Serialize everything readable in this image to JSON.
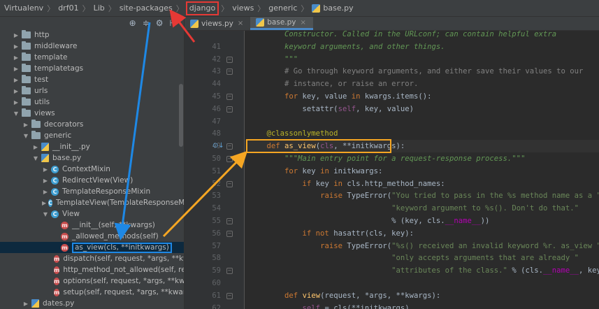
{
  "breadcrumb": {
    "items": [
      "Virtualenv",
      "drf01",
      "Lib",
      "site-packages",
      "django",
      "views",
      "generic",
      "base.py"
    ],
    "highlighted_index": 4,
    "separator": "〉"
  },
  "project_panel": {
    "toolbar_icons": [
      "crosshair-icon",
      "collapse-icon",
      "gear-icon",
      "hide-icon"
    ],
    "tree": [
      {
        "label": "http",
        "type": "folder",
        "expanded": false
      },
      {
        "label": "middleware",
        "type": "folder",
        "expanded": false
      },
      {
        "label": "template",
        "type": "folder",
        "expanded": false
      },
      {
        "label": "templatetags",
        "type": "folder",
        "expanded": false
      },
      {
        "label": "test",
        "type": "folder",
        "expanded": false
      },
      {
        "label": "urls",
        "type": "folder",
        "expanded": false
      },
      {
        "label": "utils",
        "type": "folder",
        "expanded": false
      },
      {
        "label": "views",
        "type": "folder",
        "expanded": true
      },
      {
        "label": "decorators",
        "type": "folder",
        "expanded": false
      },
      {
        "label": "generic",
        "type": "folder",
        "expanded": true
      },
      {
        "label": "__init__.py",
        "type": "file",
        "expanded": false
      },
      {
        "label": "base.py",
        "type": "file",
        "expanded": true
      },
      {
        "label": "ContextMixin",
        "type": "class",
        "expanded": false
      },
      {
        "label": "RedirectView(View)",
        "type": "class",
        "expanded": false
      },
      {
        "label": "TemplateResponseMixin",
        "type": "class",
        "expanded": false
      },
      {
        "label": "TemplateView(TemplateResponseMixin",
        "type": "class",
        "expanded": false
      },
      {
        "label": "View",
        "type": "class",
        "expanded": true
      },
      {
        "label": "__init__(self, **kwargs)",
        "type": "method"
      },
      {
        "label": "_allowed_methods(self)",
        "type": "method"
      },
      {
        "label": "as_view(cls, **initkwargs)",
        "type": "method",
        "selected": true
      },
      {
        "label": "dispatch(self, request, *args, **kwa",
        "type": "method"
      },
      {
        "label": "http_method_not_allowed(self, rec",
        "type": "method"
      },
      {
        "label": "options(self, request, *args, **kwa",
        "type": "method"
      },
      {
        "label": "setup(self, request, *args, **kwarg",
        "type": "method"
      },
      {
        "label": "dates.py",
        "type": "file",
        "expanded": false
      }
    ]
  },
  "tabs": [
    {
      "label": "views.py",
      "active": false
    },
    {
      "label": "base.py",
      "active": true
    }
  ],
  "editor": {
    "current_line": 49,
    "lines": [
      {
        "n": "",
        "tokens": [
          [
            "        Constructor. Called in the URLconf; can contain helpful extra",
            "docstr"
          ]
        ]
      },
      {
        "n": "41",
        "tokens": [
          [
            "        keyword arguments, and other things.",
            "docstr"
          ]
        ]
      },
      {
        "n": "42",
        "tokens": [
          [
            "        \"\"\"",
            "docstr"
          ]
        ]
      },
      {
        "n": "43",
        "tokens": [
          [
            "        # Go through keyword arguments, and either save their values to our",
            "cm"
          ]
        ]
      },
      {
        "n": "44",
        "tokens": [
          [
            "        # instance, or raise an error.",
            "cm"
          ]
        ]
      },
      {
        "n": "45",
        "tokens": [
          [
            "        ",
            "pl"
          ],
          [
            "for",
            "kw"
          ],
          [
            " key, value ",
            "pl"
          ],
          [
            "in",
            "kw"
          ],
          [
            " kwargs.items():",
            "pl"
          ]
        ]
      },
      {
        "n": "46",
        "tokens": [
          [
            "            setattr(",
            "pl"
          ],
          [
            "self",
            "self"
          ],
          [
            ", key, value)",
            "pl"
          ]
        ]
      },
      {
        "n": "47",
        "tokens": [
          [
            "",
            "pl"
          ]
        ]
      },
      {
        "n": "48",
        "tokens": [
          [
            "    ",
            "pl"
          ],
          [
            "@classonlymethod",
            "dec"
          ]
        ]
      },
      {
        "n": "49",
        "tokens": [
          [
            "    ",
            "pl"
          ],
          [
            "def",
            "kw"
          ],
          [
            " ",
            "pl"
          ],
          [
            "as_view",
            "fn"
          ],
          [
            "(",
            "pl"
          ],
          [
            "cls",
            "self"
          ],
          [
            ", **initkwargs):",
            "pl"
          ]
        ]
      },
      {
        "n": "50",
        "tokens": [
          [
            "        ",
            "pl"
          ],
          [
            "\"\"\"Main entry point for a request-response process.\"\"\"",
            "docstr"
          ]
        ]
      },
      {
        "n": "51",
        "tokens": [
          [
            "        ",
            "pl"
          ],
          [
            "for",
            "kw"
          ],
          [
            " key ",
            "pl"
          ],
          [
            "in",
            "kw"
          ],
          [
            " initkwargs:",
            "pl"
          ]
        ]
      },
      {
        "n": "52",
        "tokens": [
          [
            "            ",
            "pl"
          ],
          [
            "if",
            "kw"
          ],
          [
            " key ",
            "pl"
          ],
          [
            "in",
            "kw"
          ],
          [
            " cls.http_method_names:",
            "pl"
          ]
        ]
      },
      {
        "n": "53",
        "tokens": [
          [
            "                ",
            "pl"
          ],
          [
            "raise",
            "kw"
          ],
          [
            " TypeError(",
            "pl"
          ],
          [
            "\"You tried to pass in the %s method name as a \"",
            "str"
          ]
        ]
      },
      {
        "n": "54",
        "tokens": [
          [
            "                                ",
            "pl"
          ],
          [
            "\"keyword argument to %s(). Don't do that.\"",
            "str"
          ]
        ]
      },
      {
        "n": "55",
        "tokens": [
          [
            "                                % (key, cls.",
            "pl"
          ],
          [
            "__name__",
            "magic"
          ],
          [
            "))",
            "pl"
          ]
        ]
      },
      {
        "n": "56",
        "tokens": [
          [
            "            ",
            "pl"
          ],
          [
            "if not",
            "kw"
          ],
          [
            " hasattr(cls, key):",
            "pl"
          ]
        ]
      },
      {
        "n": "57",
        "tokens": [
          [
            "                ",
            "pl"
          ],
          [
            "raise",
            "kw"
          ],
          [
            " TypeError(",
            "pl"
          ],
          [
            "\"%s() received an invalid keyword %r. as_view \"",
            "str"
          ]
        ]
      },
      {
        "n": "58",
        "tokens": [
          [
            "                                ",
            "pl"
          ],
          [
            "\"only accepts arguments that are already \"",
            "str"
          ]
        ]
      },
      {
        "n": "59",
        "tokens": [
          [
            "                                ",
            "pl"
          ],
          [
            "\"attributes of the class.\"",
            "str"
          ],
          [
            " % (cls.",
            "pl"
          ],
          [
            "__name__",
            "magic"
          ],
          [
            ", key))",
            "pl"
          ]
        ]
      },
      {
        "n": "60",
        "tokens": [
          [
            "",
            "pl"
          ]
        ]
      },
      {
        "n": "61",
        "tokens": [
          [
            "        ",
            "pl"
          ],
          [
            "def",
            "kw"
          ],
          [
            " ",
            "pl"
          ],
          [
            "view",
            "fn"
          ],
          [
            "(request, *args, **kwargs):",
            "pl"
          ]
        ]
      },
      {
        "n": "62",
        "tokens": [
          [
            "            ",
            "pl"
          ],
          [
            "self",
            "self"
          ],
          [
            " = cls(**initkwargs)",
            "pl"
          ]
        ]
      }
    ]
  },
  "colors": {
    "highlight_red": "#e53935",
    "highlight_blue": "#1e88e5",
    "highlight_orange": "#f5a623",
    "selection_bg": "#0d293e"
  }
}
